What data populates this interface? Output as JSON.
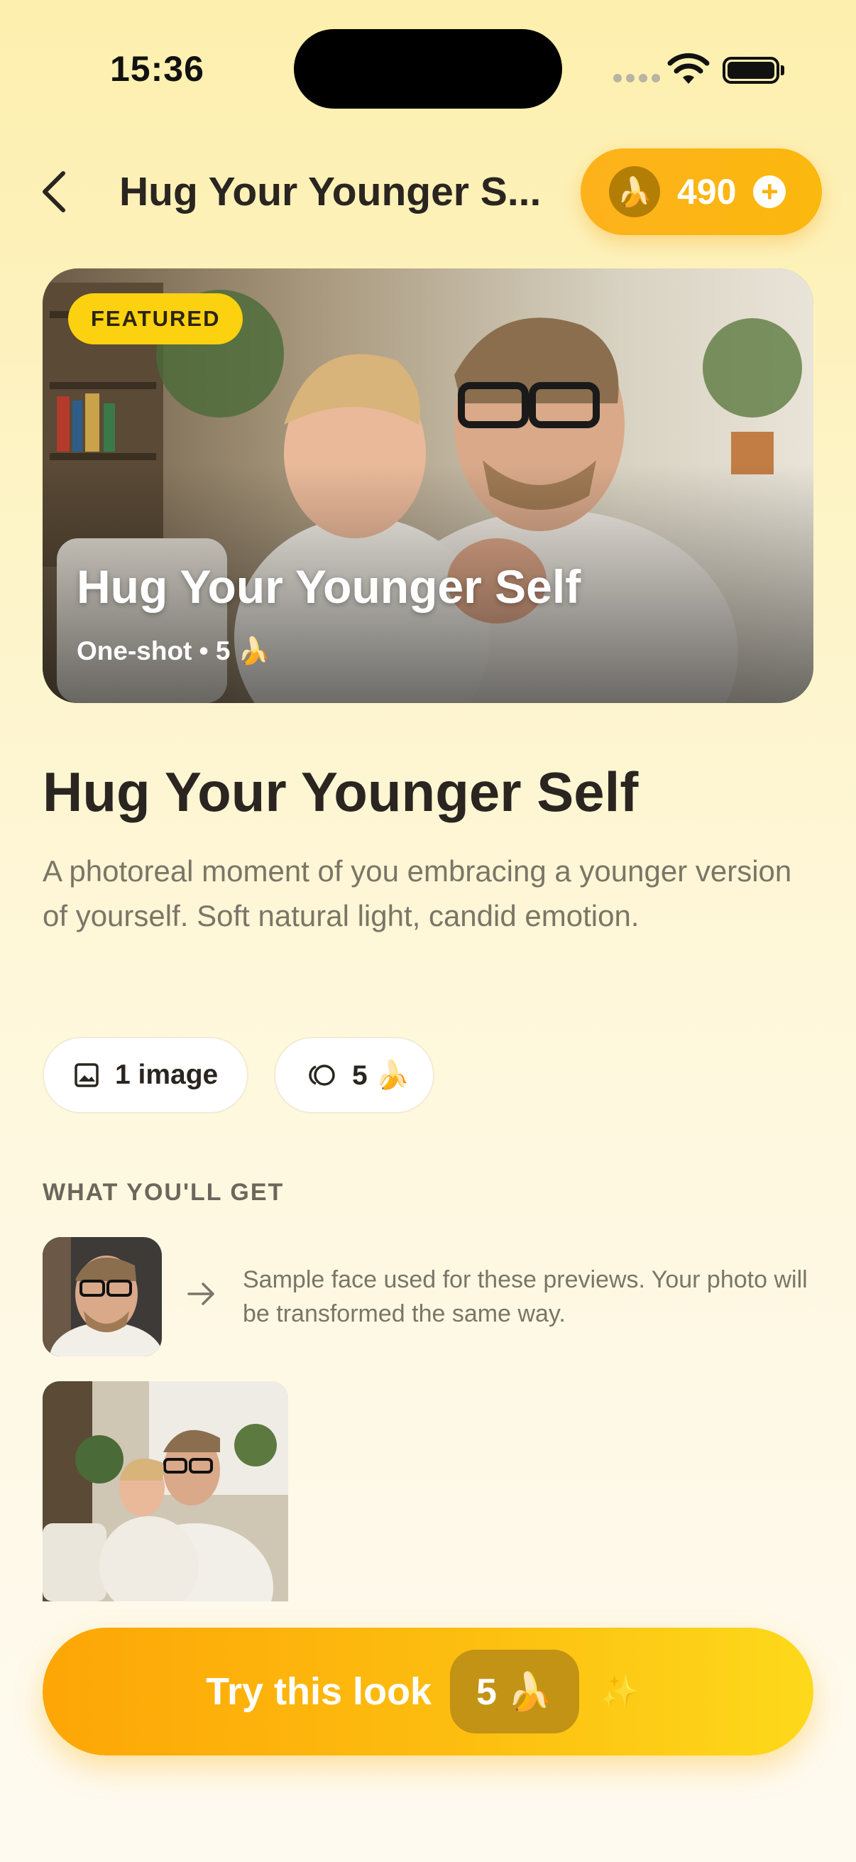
{
  "status_bar": {
    "time": "15:36"
  },
  "header": {
    "title": "Hug Your Younger S...",
    "coins": "490"
  },
  "hero": {
    "badge": "FEATURED",
    "title": "Hug Your Younger Self",
    "subtitle": "One-shot • 5 🍌"
  },
  "detail": {
    "title": "Hug Your Younger Self",
    "description": "A photoreal moment of you embracing a younger version of yourself. Soft natural light, candid emotion."
  },
  "chips": {
    "images": "1 image",
    "cost": "5 🍌"
  },
  "what_youll_get": {
    "label": "WHAT YOU'LL GET",
    "note": "Sample face used for these previews. Your photo will be transformed the same way."
  },
  "cta": {
    "label": "Try this look",
    "cost": "5 🍌",
    "sparkle": "✨"
  },
  "colors": {
    "accent": "#fdb21c",
    "badge": "#fcd10f",
    "text": "#2a2520",
    "muted": "#7b7567"
  }
}
